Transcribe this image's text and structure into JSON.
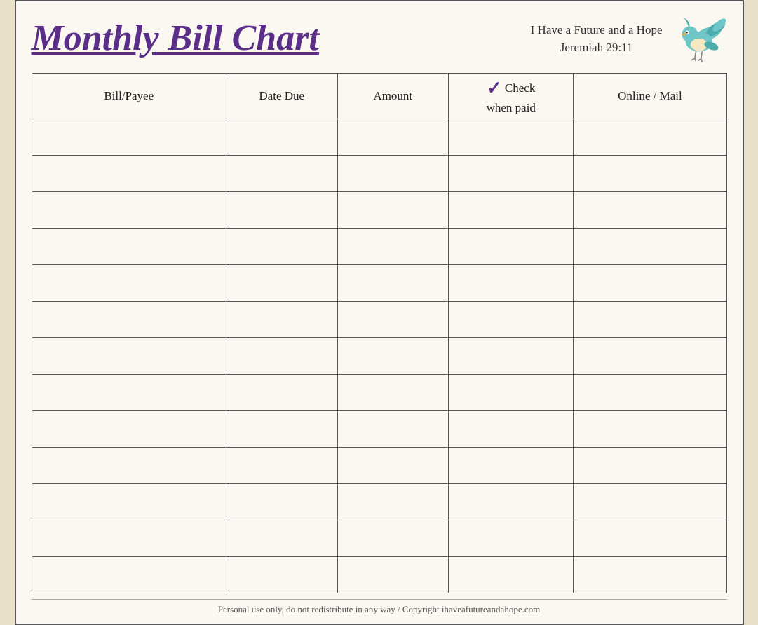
{
  "header": {
    "title": "Monthly Bill Chart",
    "verse_line1": "I Have a Future and a Hope",
    "verse_line2": "Jeremiah 29:11"
  },
  "table": {
    "columns": [
      {
        "id": "bill",
        "label": "Bill/Payee"
      },
      {
        "id": "date",
        "label": "Date Due"
      },
      {
        "id": "amount",
        "label": "Amount"
      },
      {
        "id": "check",
        "label_line1": "Check",
        "label_line2": "when paid",
        "check_symbol": "✓"
      },
      {
        "id": "online",
        "label": "Online / Mail"
      }
    ],
    "row_count": 13
  },
  "footer": {
    "text": "Personal use only, do not redistribute in any way / Copyright ihaveafutureandahope.com"
  }
}
